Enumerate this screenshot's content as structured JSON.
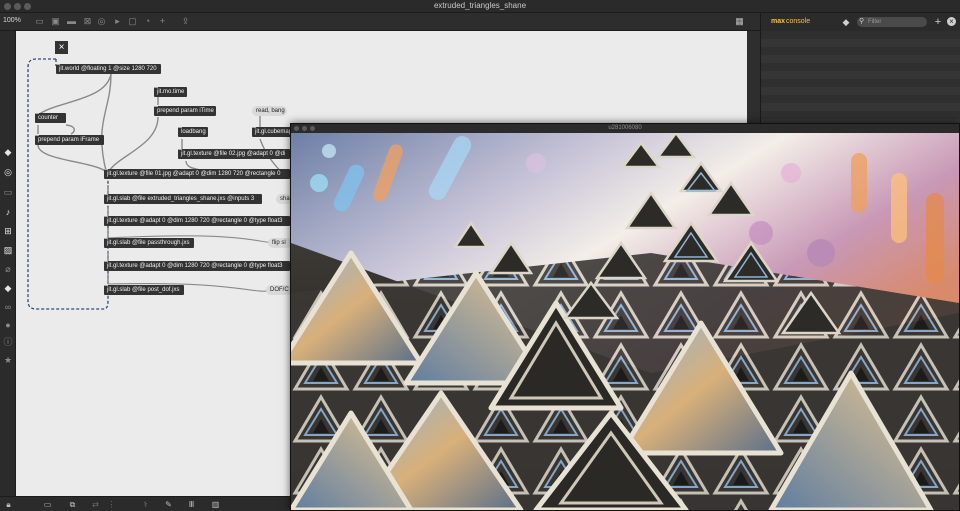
{
  "window": {
    "title": "extruded_triangles_shane"
  },
  "toolbar": {
    "zoom": "100%",
    "icons": [
      "presentation-icon",
      "object-icon",
      "comment-icon",
      "number-icon",
      "toggle-icon",
      "message-icon",
      "bang-icon",
      "dial-icon",
      "add-icon",
      "share-icon",
      "grid-icon"
    ]
  },
  "sidebar": {
    "icons": [
      "cube-icon",
      "target-icon",
      "rect-icon",
      "music-note-icon",
      "mixer-icon",
      "image-icon",
      "paperclip-icon",
      "snippet-icon",
      "loop-icon",
      "circle-icon",
      "info-icon",
      "star-icon"
    ]
  },
  "patcher": {
    "objects": [
      {
        "id": "jit-world",
        "text": "jit.world @floating 1 @size 1280 720"
      },
      {
        "id": "jit-mo-time",
        "text": "jit.mo.time"
      },
      {
        "id": "prepend-itime",
        "text": "prepend param iTime"
      },
      {
        "id": "counter",
        "text": "counter"
      },
      {
        "id": "prepend-iframe",
        "text": "prepend param iFrame"
      },
      {
        "id": "loadbang",
        "text": "loadbang"
      },
      {
        "id": "jit-gl-texture-02",
        "text": "jit.gl.texture @file 02.jpg @adapt 0 @di"
      },
      {
        "id": "jit-gl-cubemap",
        "text": "jit.gl.cubemap"
      },
      {
        "id": "jit-gl-texture-01",
        "text": "jit.gl.texture @file 01.jpg @adapt 0 @dim 1280 720 @rectangle 0"
      },
      {
        "id": "jit-gl-slab-extruded",
        "text": "jit.gl.slab @file extruded_triangles_shane.jxs @inputs 3"
      },
      {
        "id": "jit-gl-texture-float-1",
        "text": "jit.gl.texture @adapt 0 @dim 1280 720 @rectangle 0 @type float3"
      },
      {
        "id": "jit-gl-slab-passthrough",
        "text": "jit.gl.slab @file passthrough.jxs"
      },
      {
        "id": "jit-gl-texture-float-2",
        "text": "jit.gl.texture @adapt 0 @dim 1280 720 @rectangle 0 @type float3"
      },
      {
        "id": "jit-gl-slab-post-dof",
        "text": "jit.gl.slab @file post_dof.jxs"
      }
    ],
    "messages": [
      {
        "id": "read-bang",
        "text": "read, bang"
      },
      {
        "id": "sha-msg",
        "text": "sha"
      },
      {
        "id": "flip-msg",
        "text": "flip sl"
      },
      {
        "id": "dof-msg",
        "text": "DOF/C"
      }
    ],
    "closebox": "×"
  },
  "bottombar": {
    "icons": [
      "lock-icon",
      "presentation-icon",
      "new-view-icon",
      "debug-icon",
      "grid-icon",
      "wand-icon",
      "wrench-icon",
      "piano-icon",
      "keyboard-icon"
    ]
  },
  "console": {
    "brand": "max",
    "label": "console",
    "filter_placeholder": "Filter",
    "icons": [
      "diamond-icon",
      "search-icon",
      "add-icon",
      "close-icon"
    ]
  },
  "render_window": {
    "title": "u281006080"
  },
  "colors": {
    "accent": "#f5c23b",
    "canvas": "#ebebeb",
    "object": "#333333",
    "cord": "#8a8a8a",
    "selection": "#2c4b7a"
  }
}
